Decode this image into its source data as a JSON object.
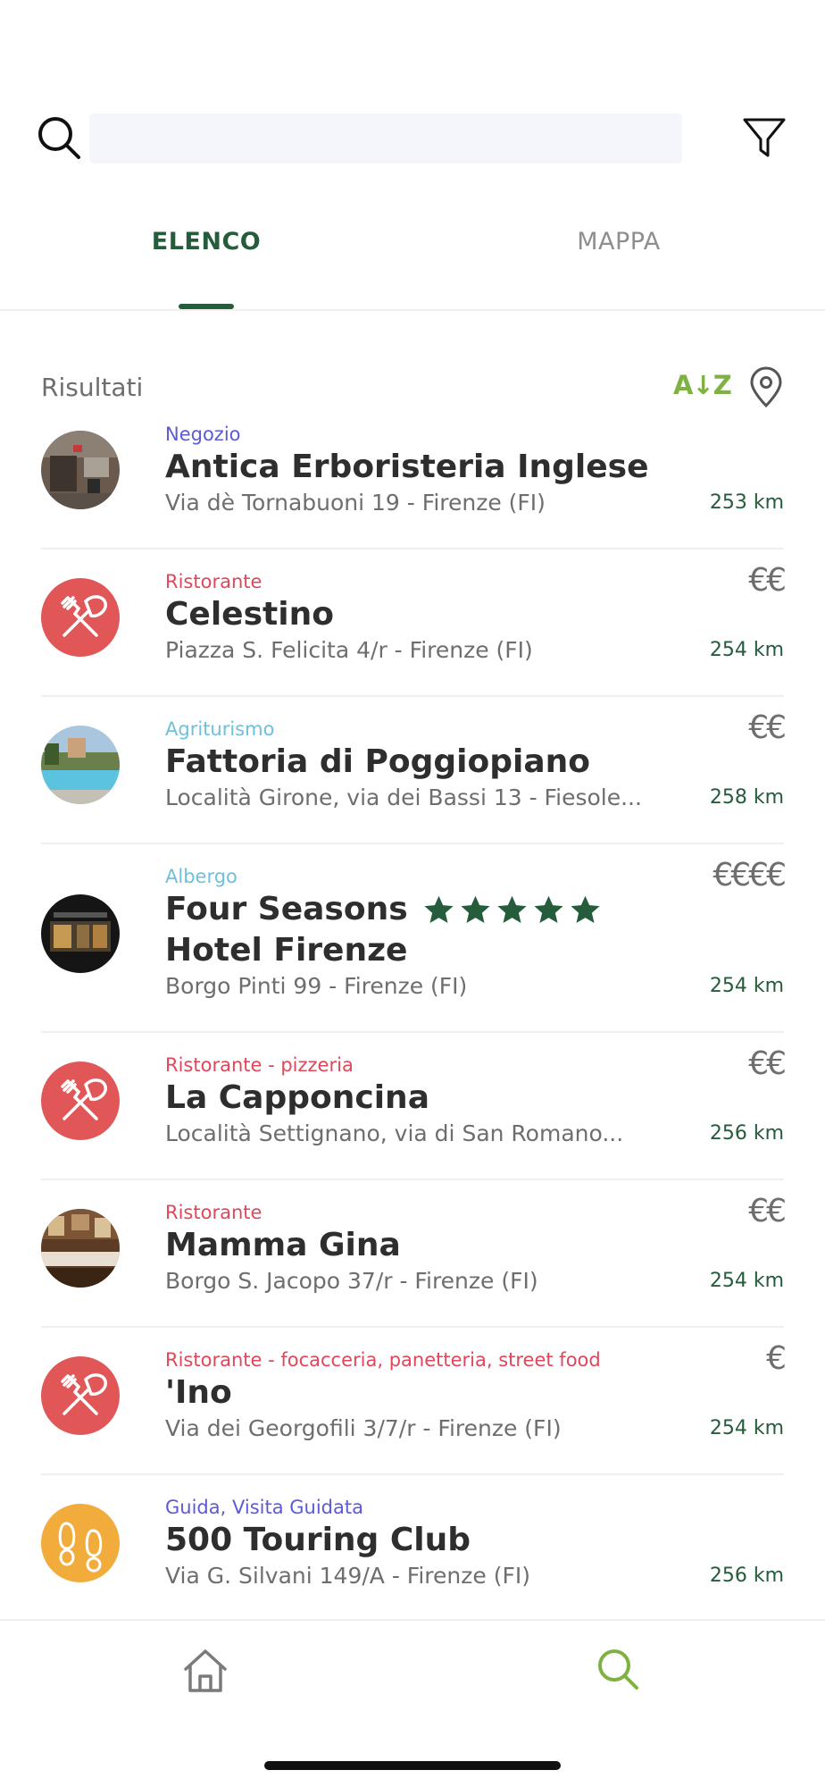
{
  "search": {
    "placeholder": ""
  },
  "tabs": [
    {
      "label": "ELENCO",
      "active": true
    },
    {
      "label": "MAPPA",
      "active": false
    }
  ],
  "results": {
    "label": "Risultati",
    "sort_label": "A↓Z"
  },
  "items": [
    {
      "category": "Negozio",
      "name": "Antica Erboristeria Inglese",
      "address": "Via dè Tornabuoni 19 - Firenze (FI)",
      "distance": "253 km",
      "price": "",
      "avatar": "photo-storefront"
    },
    {
      "category": "Ristorante",
      "name": "Celestino",
      "address": "Piazza S. Felicita 4/r - Firenze (FI)",
      "distance": "254 km",
      "price": "€€",
      "avatar": "fork-knife-icon"
    },
    {
      "category": "Agriturismo",
      "name": "Fattoria di Poggiopiano",
      "address": "Località Girone, via dei Bassi 13 - Fiesole...",
      "distance": "258 km",
      "price": "€€",
      "avatar": "photo-pool"
    },
    {
      "category": "Albergo",
      "name_line1": "Four Seasons",
      "name_line2": "Hotel Firenze",
      "address": "Borgo Pinti 99 - Firenze (FI)",
      "distance": "254 km",
      "price": "€€€€",
      "stars": 5,
      "avatar": "photo-hotel"
    },
    {
      "category": "Ristorante - pizzeria",
      "name": "La Capponcina",
      "address": "Località Settignano, via di San Romano...",
      "distance": "256 km",
      "price": "€€",
      "avatar": "fork-knife-icon"
    },
    {
      "category": "Ristorante",
      "name": "Mamma Gina",
      "address": "Borgo S. Jacopo 37/r - Firenze (FI)",
      "distance": "254 km",
      "price": "€€",
      "avatar": "photo-dining-room"
    },
    {
      "category": "Ristorante - focacceria, panetteria, street food",
      "name": "'Ino",
      "address": "Via dei Georgofili 3/7/r - Firenze (FI)",
      "distance": "254 km",
      "price": "€",
      "avatar": "fork-knife-icon"
    },
    {
      "category": "Guida, Visita Guidata",
      "name": "500 Touring Club",
      "address": "Via G. Silvani 149/A - Firenze (FI)",
      "distance": "256 km",
      "price": "",
      "avatar": "footprints-icon"
    }
  ],
  "colors": {
    "accent_green": "#245c3c",
    "sort_green": "#7fb242",
    "restaurant_red": "#e15757",
    "guide_yellow": "#f1ac3c"
  },
  "bottom_nav": [
    {
      "icon": "home-icon",
      "active": false
    },
    {
      "icon": "search-icon",
      "active": true
    }
  ]
}
